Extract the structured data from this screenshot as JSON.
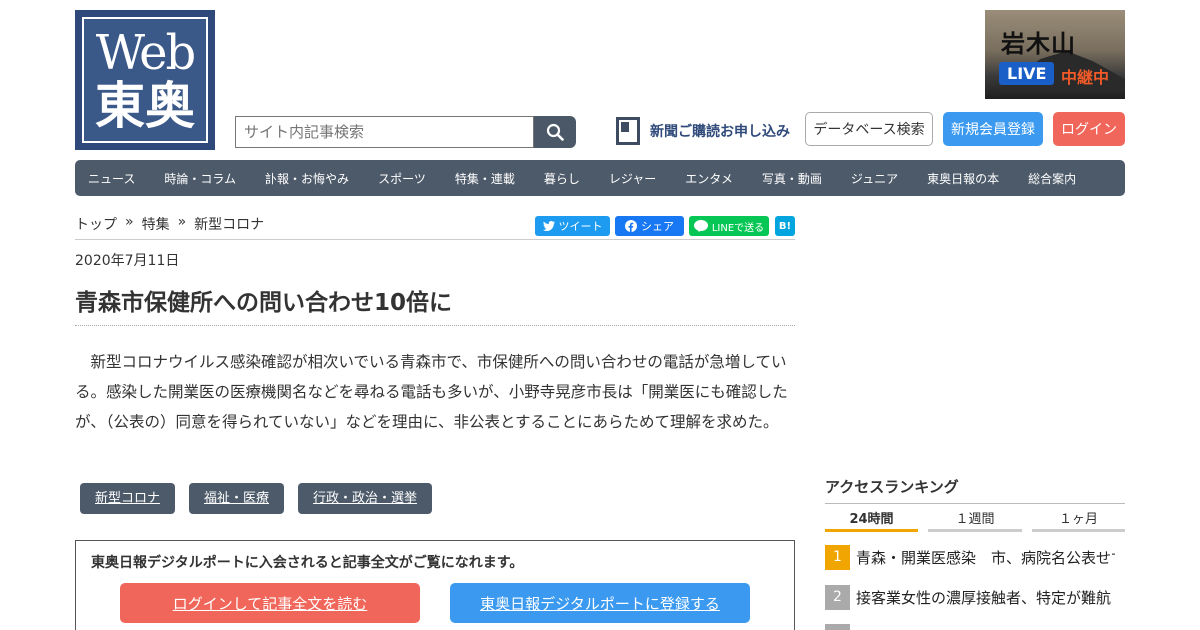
{
  "header": {
    "logo_top": "Web",
    "logo_bottom": "東奥",
    "search_placeholder": "サイト内記事検索",
    "subscribe_label": "新聞ご購読お申し込み",
    "database_label": "データベース検索",
    "register_label": "新規会員登録",
    "login_label": "ログイン",
    "live_banner": {
      "title": "岩木山",
      "badge": "LIVE",
      "relay": "中継中"
    }
  },
  "nav": {
    "items": [
      "ニュース",
      "時論・コラム",
      "訃報・お悔やみ",
      "スポーツ",
      "特集・連載",
      "暮らし",
      "レジャー",
      "エンタメ",
      "写真・動画",
      "ジュニア",
      "東奥日報の本",
      "総合案内"
    ]
  },
  "breadcrumb": {
    "items": [
      "トップ",
      "特集",
      "新型コロナ"
    ],
    "separator": "»"
  },
  "share": {
    "tweet": "ツイート",
    "facebook": "シェア",
    "line": "LINEで送る",
    "hatena": "B!"
  },
  "article": {
    "date": "2020年7月11日",
    "title": "青森市保健所への問い合わせ10倍に",
    "body": "新型コロナウイルス感染確認が相次いでいる青森市で、市保健所への問い合わせの電話が急増している。感染した開業医の医療機関名などを尋ねる電話も多いが、小野寺晃彦市長は「開業医にも確認したが、（公表の）同意を得られていない」などを理由に、非公表とすることにあらためて理解を求めた。",
    "tags": [
      "新型コロナ",
      "福祉・医療",
      "行政・政治・選挙"
    ]
  },
  "paywall": {
    "message": "東奥日報デジタルポートに入会されると記事全文がご覧になれます。",
    "login_button": "ログインして記事全文を読む",
    "register_button": "東奥日報デジタルポートに登録する"
  },
  "ranking": {
    "title": "アクセスランキング",
    "tabs": [
      "24時間",
      "１週間",
      "１ヶ月"
    ],
    "items": [
      {
        "rank": "1",
        "text": "青森・開業医感染　市、病院名公表せず"
      },
      {
        "rank": "2",
        "text": "接客業女性の濃厚接触者、特定が難航"
      }
    ]
  },
  "colors": {
    "nav_bg": "#4d5a6a",
    "accent_blue": "#3b9af0",
    "accent_red": "#f0665a",
    "rank_first": "#f0a500",
    "rank_other": "#aaaaaa"
  }
}
